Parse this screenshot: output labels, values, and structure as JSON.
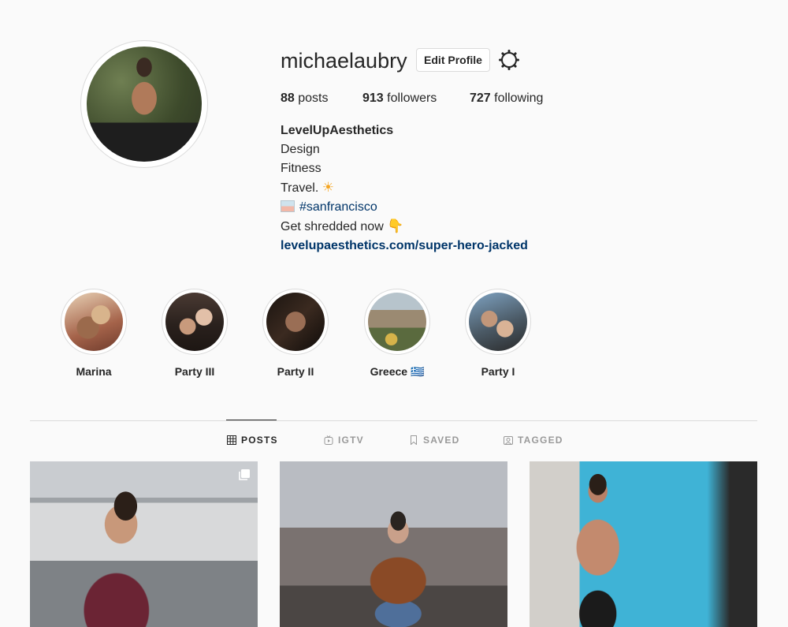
{
  "profile": {
    "username": "michaelaubry",
    "edit_button": "Edit Profile",
    "settings_icon": "gear-icon"
  },
  "stats": {
    "posts_count": "88",
    "posts_label": "posts",
    "followers_count": "913",
    "followers_label": "followers",
    "following_count": "727",
    "following_label": "following"
  },
  "bio": {
    "name": "LevelUpAesthetics",
    "line1": "Design",
    "line2": "Fitness",
    "line3": "Travel.",
    "hashtag": "#sanfrancisco",
    "cta": "Get shredded now",
    "link": "levelupaesthetics.com/super-hero-jacked"
  },
  "highlights": [
    {
      "label": "Marina"
    },
    {
      "label": "Party III"
    },
    {
      "label": "Party II"
    },
    {
      "label": "Greece 🇬🇷"
    },
    {
      "label": "Party I"
    }
  ],
  "tabs": [
    {
      "label": "POSTS",
      "icon": "grid-icon",
      "active": true
    },
    {
      "label": "IGTV",
      "icon": "igtv-icon",
      "active": false
    },
    {
      "label": "SAVED",
      "icon": "bookmark-icon",
      "active": false
    },
    {
      "label": "TAGGED",
      "icon": "tagged-icon",
      "active": false
    }
  ],
  "colors": {
    "background": "#fafafa",
    "text": "#262626",
    "link": "#003569",
    "border": "#dbdbdb",
    "inactive_tab": "#999999"
  }
}
